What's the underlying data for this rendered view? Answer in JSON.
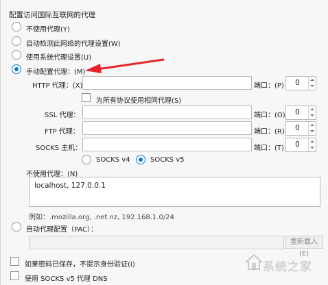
{
  "section_title": "配置访问国际互联网的代理",
  "options": {
    "no_proxy": "不使用代理(Y)",
    "auto_detect": "自动检测此网络的代理设置(W)",
    "system_proxy": "使用系统代理设置(U)",
    "manual": "手动配置代理：(M)"
  },
  "manual": {
    "http_label": "HTTP 代理：(X)",
    "http_value": "",
    "http_port_label": "端口：(P)",
    "http_port": "0",
    "same_proxy_label": "为所有协议使用相同代理(S)",
    "ssl_label": "SSL 代理：",
    "ssl_value": "",
    "ssl_port_label": "端口：(O)",
    "ssl_port": "0",
    "ftp_label": "FTP 代理：",
    "ftp_value": "",
    "ftp_port_label": "端口：(R)",
    "ftp_port": "0",
    "socks_label": "SOCKS 主机：",
    "socks_value": "",
    "socks_port_label": "端口：(T)",
    "socks_port": "0",
    "socks_v4": "SOCKS v4",
    "socks_v5": "SOCKS v5"
  },
  "no_proxy_for": {
    "label": "不使用代理：(N)",
    "value": "localhost, 127.0.0.1",
    "example": "例如：.mozilla.org, .net.nz, 192.168.1.0/24"
  },
  "auto_config": {
    "label": "自动代理配置（PAC）：",
    "url": "",
    "reload": "重新载入(E)"
  },
  "checkboxes": {
    "no_prompt_auth": "如果密码已保存，不提示身份验证(I)",
    "socks_dns": "使用 SOCKS v5 代理 DNS"
  },
  "watermark": "系统之家",
  "colors": {
    "accent": "#0a78d7",
    "annotation_arrow": "#e8242a"
  }
}
